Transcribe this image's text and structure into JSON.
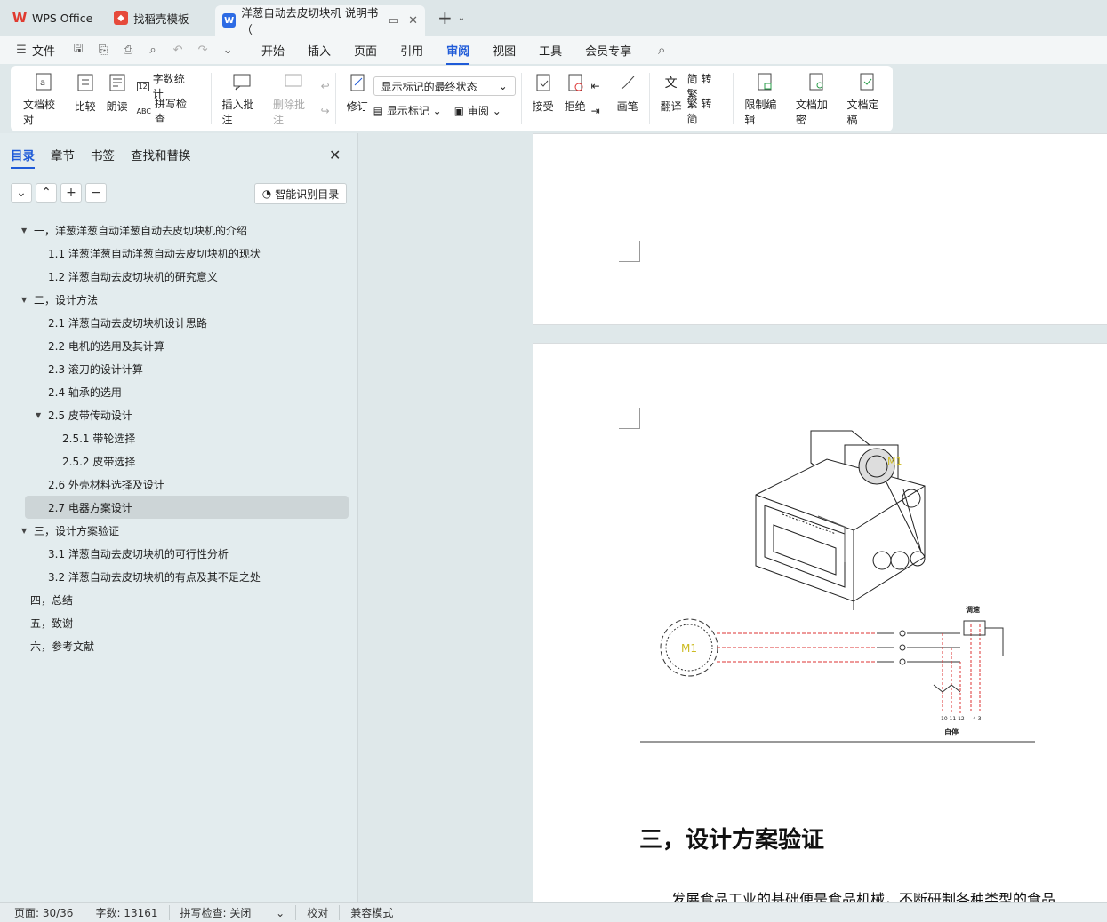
{
  "tabs": [
    {
      "label": "WPS Office",
      "icon": "wps-logo"
    },
    {
      "label": "找稻壳模板",
      "icon": "docer-logo"
    },
    {
      "label": "洋葱自动去皮切块机 说明书（",
      "icon": "word-logo"
    }
  ],
  "menu": {
    "file": "文件",
    "items": [
      "开始",
      "插入",
      "页面",
      "引用",
      "审阅",
      "视图",
      "工具",
      "会员专享"
    ],
    "active": "审阅"
  },
  "ribbon": {
    "proofread": "文档校对",
    "compare": "比较",
    "read_aloud": "朗读",
    "word_count": "字数统计",
    "spell_check": "拼写检查",
    "insert_comment": "插入批注",
    "delete_comment": "删除批注",
    "track_changes": "修订",
    "markup_state": "显示标记的最终状态",
    "show_markup": "显示标记",
    "review": "审阅",
    "accept": "接受",
    "reject": "拒绝",
    "pen": "画笔",
    "translate": "翻译",
    "to_traditional": "简 转繁",
    "to_simplified": "繁 转简",
    "restrict_edit": "限制编辑",
    "encrypt": "文档加密",
    "finalize": "文档定稿"
  },
  "panel": {
    "tabs": [
      "目录",
      "章节",
      "书签",
      "查找和替换"
    ],
    "active_tab": "目录",
    "smart_toc": "智能识别目录",
    "toc": [
      {
        "level": 1,
        "text": "一，洋葱洋葱自动洋葱自动去皮切块机的介绍",
        "expanded": true
      },
      {
        "level": 2,
        "text": "1.1 洋葱洋葱自动洋葱自动去皮切块机的现状"
      },
      {
        "level": 2,
        "text": "1.2 洋葱自动去皮切块机的研究意义"
      },
      {
        "level": 1,
        "text": "二，设计方法",
        "expanded": true
      },
      {
        "level": 2,
        "text": "2.1 洋葱自动去皮切块机设计思路"
      },
      {
        "level": 2,
        "text": "2.2 电机的选用及其计算"
      },
      {
        "level": 2,
        "text": "2.3 滚刀的设计计算"
      },
      {
        "level": 2,
        "text": "2.4 轴承的选用"
      },
      {
        "level": 2,
        "text": "2.5 皮带传动设计",
        "expanded": true
      },
      {
        "level": 3,
        "text": "2.5.1 带轮选择"
      },
      {
        "level": 3,
        "text": "2.5.2 皮带选择"
      },
      {
        "level": 2,
        "text": "2.6 外壳材料选择及设计"
      },
      {
        "level": 2,
        "text": "2.7 电器方案设计",
        "selected": true
      },
      {
        "level": 1,
        "text": "三，设计方案验证",
        "expanded": true
      },
      {
        "level": 2,
        "text": "3.1 洋葱自动去皮切块机的可行性分析"
      },
      {
        "level": 2,
        "text": "3.2 洋葱自动去皮切块机的有点及其不足之处"
      },
      {
        "level": 1,
        "text": "四，总结"
      },
      {
        "level": 1,
        "text": "五，致谢"
      },
      {
        "level": 1,
        "text": "六，参考文献"
      }
    ]
  },
  "document": {
    "heading": "三，设计方案验证",
    "paragraph_start": "发展食品工业的基础便是食品机械，不断研制各种类型的食品",
    "figure_labels": {
      "motor": "M1",
      "top_label": "调速",
      "bottom_label": "自停"
    }
  },
  "status": {
    "page": "页面: 30/36",
    "words": "字数: 13161",
    "spell": "拼写检查: 关闭",
    "proof": "校对",
    "compat": "兼容模式"
  },
  "colors": {
    "accent": "#1f5bd8",
    "wps_red": "#e03a2f",
    "word_blue": "#2d6be4"
  }
}
